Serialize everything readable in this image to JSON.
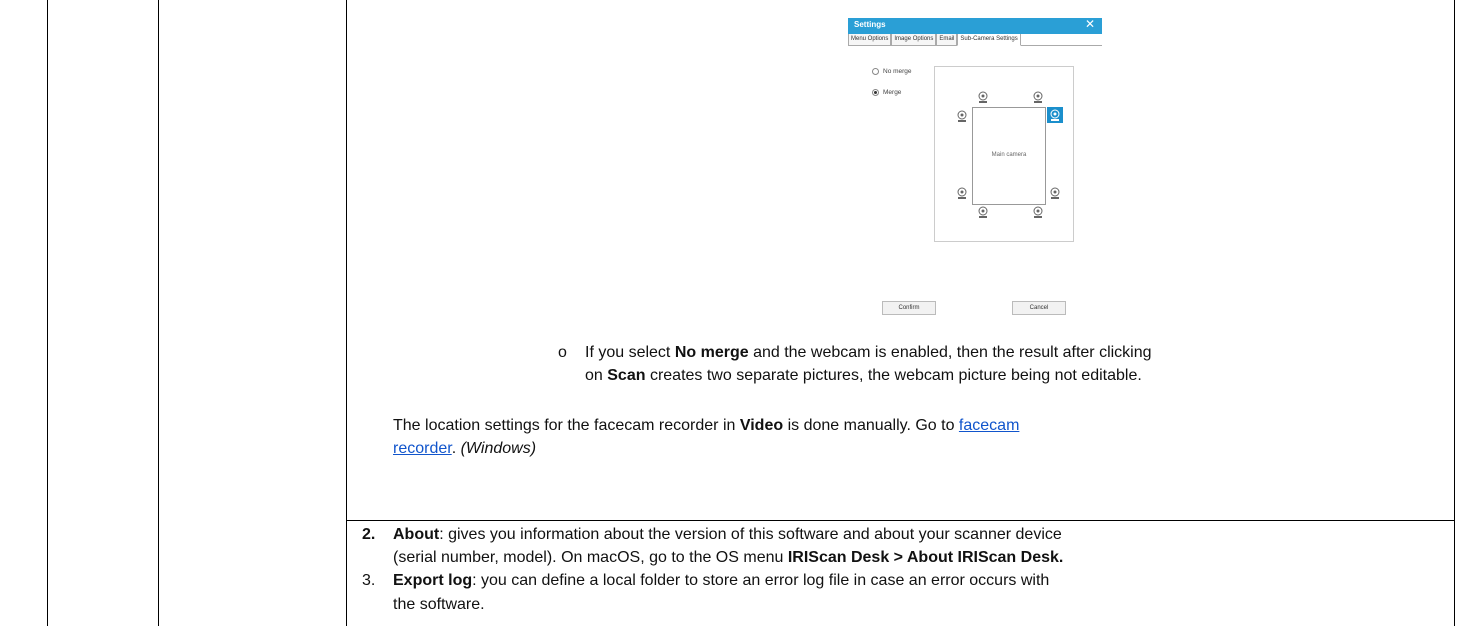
{
  "dialog": {
    "title": "Settings",
    "close_glyph": "✕",
    "tabs": [
      "Menu Options",
      "Image Options",
      "Email",
      "Sub-Camera Settings"
    ],
    "radio_no_merge": "No merge",
    "radio_merge": "Merge",
    "selected_option": "Merge",
    "main_camera_label": "Main camera",
    "confirm_label": "Confirm",
    "cancel_label": "Cancel",
    "camera_icon": "webcam-icon",
    "accent_color": "#2a9fd6"
  },
  "bullet": {
    "marker": "o",
    "line1_pre": "If you select ",
    "line1_bold1": "No merge",
    "line1_post": " and the webcam is enabled, then the result after clicking",
    "line2_pre": "on ",
    "line2_bold": "Scan",
    "line2_post": " creates two separate pictures, the webcam picture being not editable."
  },
  "location_para": {
    "pre": "The location settings for the facecam recorder in ",
    "bold": "Video",
    "mid": " is done manually. Go to ",
    "link1": "facecam",
    "link2": "recorder",
    "post": ". ",
    "italic": "(Windows)"
  },
  "item2": {
    "number": "2.",
    "bold": "About",
    "text1": ": gives you information about the version of this software and about your scanner device",
    "text2_pre": "(serial number, model). On macOS, go to the OS menu ",
    "text2_bold": "IRIScan Desk > About IRIScan Desk."
  },
  "item3": {
    "number": "3.",
    "bold": "Export log",
    "text1": ": you can define a local folder to store an error log file in case an error occurs with",
    "text2": "the software."
  }
}
